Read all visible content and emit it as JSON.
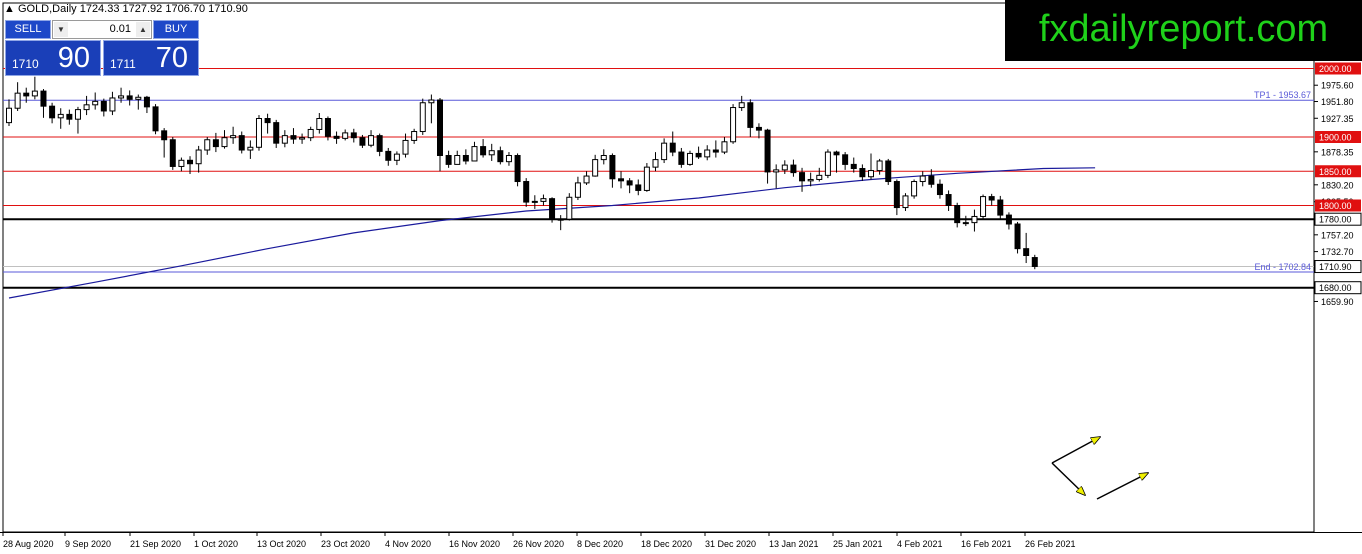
{
  "header": {
    "symbol": "GOLD,Daily",
    "ohlc": "1724.33 1727.92 1706.70 1710.90"
  },
  "brand": {
    "text": "fxdailyreport.com",
    "color": "#1fd11a"
  },
  "trade_panel": {
    "sell_label": "SELL",
    "buy_label": "BUY",
    "lot": "0.01",
    "sell_price_small": "1710",
    "sell_price_big": "90",
    "buy_price_small": "1711",
    "buy_price_big": "70"
  },
  "chart_data": {
    "type": "candlestick",
    "y_range": [
      1659.9,
      2012.5
    ],
    "y_ticks": [
      "1975.60",
      "1951.80",
      "1927.35",
      "1878.35",
      "1830.20",
      "1805.50",
      "1757.20",
      "1732.70",
      "1659.90"
    ],
    "x_ticks": [
      "28 Aug 2020",
      "9 Sep 2020",
      "21 Sep 2020",
      "1 Oct 2020",
      "13 Oct 2020",
      "23 Oct 2020",
      "4 Nov 2020",
      "16 Nov 2020",
      "26 Nov 2020",
      "8 Dec 2020",
      "18 Dec 2020",
      "31 Dec 2020",
      "13 Jan 2021",
      "25 Jan 2021",
      "4 Feb 2021",
      "16 Feb 2021",
      "26 Feb 2021"
    ],
    "horizontal_levels": [
      {
        "value": 2000.0,
        "label": "2000.00",
        "color": "#e01010",
        "style": "red"
      },
      {
        "value": 1953.67,
        "label": "TP1 - 1953.67",
        "color": "#5a5ad8",
        "style": "target"
      },
      {
        "value": 1900.0,
        "label": "1900.00",
        "color": "#e01010",
        "style": "red"
      },
      {
        "value": 1850.0,
        "label": "1850.00",
        "color": "#e01010",
        "style": "red"
      },
      {
        "value": 1800.0,
        "label": "1800.00",
        "color": "#e01010",
        "style": "red"
      },
      {
        "value": 1780.0,
        "label": "1780.00",
        "color": "#000000",
        "style": "black"
      },
      {
        "value": 1702.84,
        "label": "End - 1702.84",
        "color": "#5a5ad8",
        "style": "target"
      },
      {
        "value": 1680.0,
        "label": "1680.00",
        "color": "#000000",
        "style": "black"
      }
    ],
    "current_price": {
      "value": 1710.9,
      "label": "1710.90"
    },
    "moving_average": {
      "color": "#1a1a9c",
      "points": [
        [
          0,
          1665
        ],
        [
          10,
          1688
        ],
        [
          20,
          1712
        ],
        [
          30,
          1737
        ],
        [
          40,
          1760
        ],
        [
          50,
          1778
        ],
        [
          60,
          1792
        ],
        [
          70,
          1800
        ],
        [
          80,
          1811
        ],
        [
          90,
          1826
        ],
        [
          100,
          1838
        ],
        [
          110,
          1847
        ],
        [
          120,
          1854
        ],
        [
          126,
          1855
        ]
      ]
    },
    "candles": [
      [
        1921,
        1942,
        1955,
        1916
      ],
      [
        1942,
        1964,
        1980,
        1938
      ],
      [
        1964,
        1960,
        1972,
        1950
      ],
      [
        1960,
        1967,
        1988,
        1955
      ],
      [
        1967,
        1945,
        1970,
        1928
      ],
      [
        1945,
        1928,
        1950,
        1920
      ],
      [
        1928,
        1933,
        1942,
        1912
      ],
      [
        1933,
        1926,
        1940,
        1918
      ],
      [
        1926,
        1940,
        1944,
        1905
      ],
      [
        1940,
        1947,
        1960,
        1932
      ],
      [
        1947,
        1952,
        1965,
        1940
      ],
      [
        1952,
        1938,
        1956,
        1930
      ],
      [
        1938,
        1957,
        1966,
        1932
      ],
      [
        1957,
        1960,
        1972,
        1950
      ],
      [
        1960,
        1955,
        1968,
        1946
      ],
      [
        1955,
        1958,
        1962,
        1940
      ],
      [
        1958,
        1944,
        1960,
        1935
      ],
      [
        1944,
        1909,
        1948,
        1904
      ],
      [
        1909,
        1896,
        1913,
        1870
      ],
      [
        1896,
        1857,
        1900,
        1852
      ],
      [
        1857,
        1866,
        1870,
        1850
      ],
      [
        1866,
        1861,
        1872,
        1846
      ],
      [
        1861,
        1881,
        1887,
        1848
      ],
      [
        1881,
        1896,
        1900,
        1874
      ],
      [
        1896,
        1886,
        1906,
        1878
      ],
      [
        1886,
        1899,
        1910,
        1883
      ],
      [
        1899,
        1902,
        1915,
        1890
      ],
      [
        1902,
        1881,
        1908,
        1876
      ],
      [
        1881,
        1885,
        1895,
        1868
      ],
      [
        1885,
        1927,
        1932,
        1880
      ],
      [
        1927,
        1921,
        1934,
        1905
      ],
      [
        1921,
        1891,
        1925,
        1884
      ],
      [
        1891,
        1902,
        1910,
        1885
      ],
      [
        1902,
        1897,
        1913,
        1890
      ],
      [
        1897,
        1899,
        1905,
        1890
      ],
      [
        1899,
        1911,
        1915,
        1894
      ],
      [
        1911,
        1927,
        1935,
        1905
      ],
      [
        1927,
        1901,
        1930,
        1895
      ],
      [
        1901,
        1898,
        1908,
        1890
      ],
      [
        1898,
        1906,
        1911,
        1895
      ],
      [
        1906,
        1899,
        1912,
        1892
      ],
      [
        1899,
        1888,
        1903,
        1884
      ],
      [
        1888,
        1902,
        1910,
        1885
      ],
      [
        1902,
        1879,
        1905,
        1872
      ],
      [
        1879,
        1866,
        1884,
        1858
      ],
      [
        1866,
        1875,
        1879,
        1859
      ],
      [
        1875,
        1895,
        1905,
        1870
      ],
      [
        1895,
        1908,
        1912,
        1890
      ],
      [
        1908,
        1950,
        1956,
        1903
      ],
      [
        1950,
        1954,
        1962,
        1920
      ],
      [
        1954,
        1873,
        1957,
        1850
      ],
      [
        1873,
        1860,
        1880,
        1855
      ],
      [
        1860,
        1873,
        1880,
        1862
      ],
      [
        1873,
        1865,
        1882,
        1860
      ],
      [
        1865,
        1886,
        1893,
        1865
      ],
      [
        1886,
        1874,
        1897,
        1870
      ],
      [
        1874,
        1880,
        1890,
        1865
      ],
      [
        1880,
        1864,
        1886,
        1860
      ],
      [
        1864,
        1873,
        1878,
        1858
      ],
      [
        1873,
        1835,
        1876,
        1828
      ],
      [
        1835,
        1805,
        1840,
        1798
      ],
      [
        1805,
        1806,
        1815,
        1795
      ],
      [
        1806,
        1810,
        1816,
        1800
      ],
      [
        1810,
        1780,
        1812,
        1775
      ],
      [
        1780,
        1780,
        1786,
        1764
      ],
      [
        1780,
        1812,
        1818,
        1778
      ],
      [
        1812,
        1833,
        1842,
        1808
      ],
      [
        1833,
        1843,
        1850,
        1830
      ],
      [
        1843,
        1867,
        1874,
        1842
      ],
      [
        1867,
        1873,
        1882,
        1860
      ],
      [
        1873,
        1839,
        1876,
        1826
      ],
      [
        1839,
        1836,
        1850,
        1825
      ],
      [
        1836,
        1830,
        1840,
        1818
      ],
      [
        1830,
        1822,
        1838,
        1815
      ],
      [
        1822,
        1856,
        1862,
        1820
      ],
      [
        1856,
        1867,
        1878,
        1850
      ],
      [
        1867,
        1891,
        1898,
        1862
      ],
      [
        1891,
        1878,
        1908,
        1872
      ],
      [
        1878,
        1860,
        1884,
        1855
      ],
      [
        1860,
        1876,
        1880,
        1858
      ],
      [
        1876,
        1871,
        1886,
        1868
      ],
      [
        1871,
        1881,
        1888,
        1866
      ],
      [
        1881,
        1878,
        1895,
        1870
      ],
      [
        1878,
        1893,
        1900,
        1875
      ],
      [
        1893,
        1943,
        1948,
        1890
      ],
      [
        1943,
        1950,
        1960,
        1938
      ],
      [
        1950,
        1914,
        1955,
        1900
      ],
      [
        1914,
        1910,
        1920,
        1898
      ],
      [
        1910,
        1849,
        1912,
        1832
      ],
      [
        1849,
        1852,
        1860,
        1825
      ],
      [
        1852,
        1859,
        1866,
        1846
      ],
      [
        1859,
        1848,
        1867,
        1842
      ],
      [
        1848,
        1836,
        1855,
        1820
      ],
      [
        1836,
        1838,
        1848,
        1828
      ],
      [
        1838,
        1844,
        1855,
        1835
      ],
      [
        1844,
        1878,
        1882,
        1840
      ],
      [
        1878,
        1874,
        1880,
        1848
      ],
      [
        1874,
        1860,
        1878,
        1852
      ],
      [
        1860,
        1854,
        1870,
        1848
      ],
      [
        1854,
        1842,
        1860,
        1836
      ],
      [
        1842,
        1851,
        1876,
        1838
      ],
      [
        1851,
        1865,
        1868,
        1845
      ],
      [
        1865,
        1835,
        1868,
        1830
      ],
      [
        1835,
        1797,
        1838,
        1786
      ],
      [
        1797,
        1814,
        1818,
        1792
      ],
      [
        1814,
        1835,
        1838,
        1810
      ],
      [
        1835,
        1843,
        1850,
        1828
      ],
      [
        1843,
        1831,
        1853,
        1826
      ],
      [
        1831,
        1816,
        1838,
        1810
      ],
      [
        1816,
        1800,
        1822,
        1792
      ],
      [
        1800,
        1775,
        1804,
        1768
      ],
      [
        1775,
        1775,
        1785,
        1770
      ],
      [
        1775,
        1784,
        1794,
        1762
      ],
      [
        1784,
        1813,
        1816,
        1780
      ],
      [
        1813,
        1808,
        1817,
        1800
      ],
      [
        1808,
        1786,
        1814,
        1780
      ],
      [
        1786,
        1773,
        1790,
        1765
      ],
      [
        1773,
        1737,
        1776,
        1730
      ],
      [
        1737,
        1727,
        1760,
        1716
      ],
      [
        1724,
        1711,
        1728,
        1707
      ]
    ],
    "projection_path": [
      {
        "points": [
          [
            1052,
            463
          ],
          [
            1100,
            437
          ]
        ],
        "arrow": "end"
      },
      {
        "points": [
          [
            1052,
            463
          ],
          [
            1085,
            495
          ]
        ],
        "arrow": "end"
      },
      {
        "points": [
          [
            1097,
            499
          ],
          [
            1148,
            473
          ]
        ],
        "arrow": "end"
      }
    ],
    "arrow_color": "#f0f000"
  }
}
